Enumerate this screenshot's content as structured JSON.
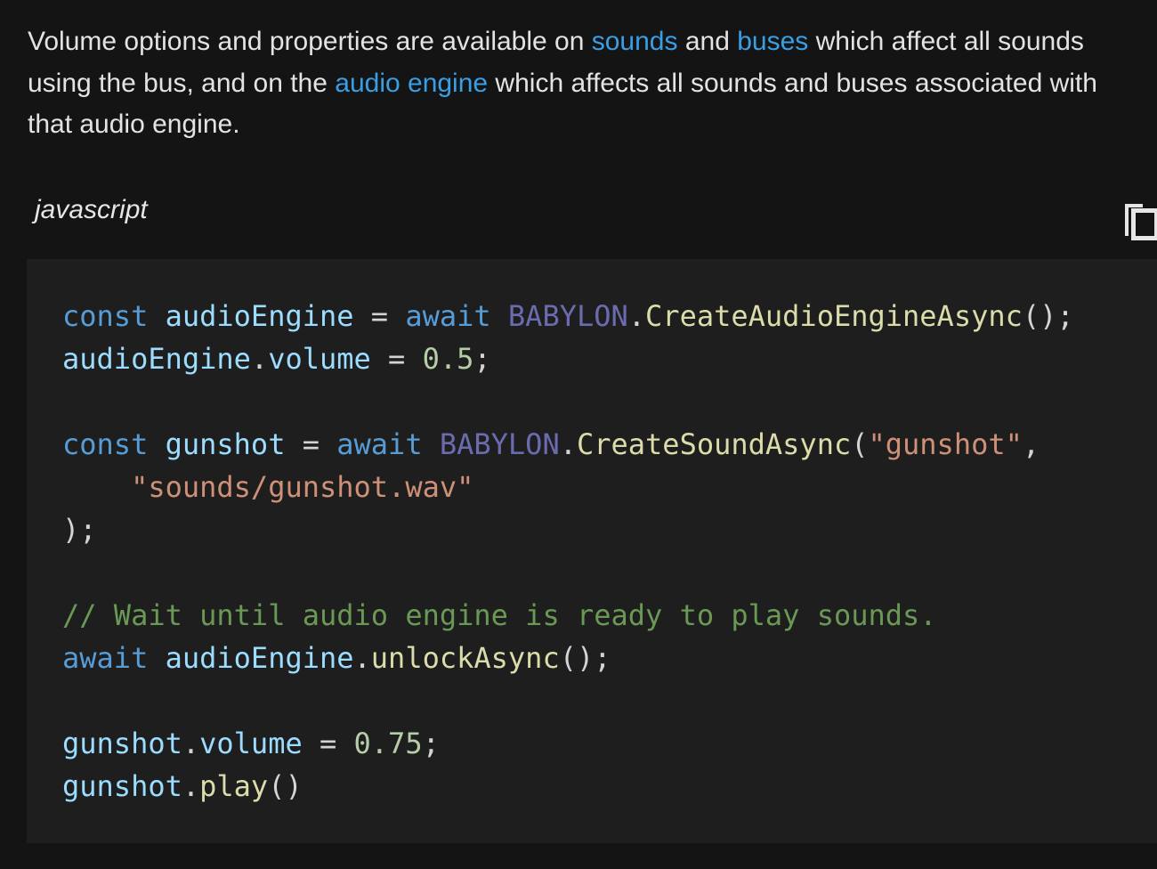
{
  "intro": {
    "t1": "Volume options and properties are available on ",
    "link_sounds": "sounds",
    "t2": " and ",
    "link_buses": "buses",
    "t3": " which affect all sounds using the bus, and on the ",
    "link_audio_engine": "audio engine",
    "t4": " which affects all sounds and buses associated with that audio engine."
  },
  "code_block": {
    "language": "javascript",
    "copy_icon": "copy-icon",
    "lines": [
      [
        {
          "t": "const",
          "c": "kw"
        },
        {
          "t": " ",
          "c": "pun"
        },
        {
          "t": "audioEngine",
          "c": "var"
        },
        {
          "t": " = ",
          "c": "pun"
        },
        {
          "t": "await",
          "c": "kw"
        },
        {
          "t": " ",
          "c": "pun"
        },
        {
          "t": "BABYLON",
          "c": "cls"
        },
        {
          "t": ".",
          "c": "pun"
        },
        {
          "t": "CreateAudioEngineAsync",
          "c": "fn"
        },
        {
          "t": "();",
          "c": "pun"
        }
      ],
      [
        {
          "t": "audioEngine",
          "c": "var"
        },
        {
          "t": ".",
          "c": "pun"
        },
        {
          "t": "volume",
          "c": "var"
        },
        {
          "t": " = ",
          "c": "pun"
        },
        {
          "t": "0.5",
          "c": "num"
        },
        {
          "t": ";",
          "c": "pun"
        }
      ],
      [],
      [
        {
          "t": "const",
          "c": "kw"
        },
        {
          "t": " ",
          "c": "pun"
        },
        {
          "t": "gunshot",
          "c": "var"
        },
        {
          "t": " = ",
          "c": "pun"
        },
        {
          "t": "await",
          "c": "kw"
        },
        {
          "t": " ",
          "c": "pun"
        },
        {
          "t": "BABYLON",
          "c": "cls"
        },
        {
          "t": ".",
          "c": "pun"
        },
        {
          "t": "CreateSoundAsync",
          "c": "fn"
        },
        {
          "t": "(",
          "c": "pun"
        },
        {
          "t": "\"gunshot\"",
          "c": "str"
        },
        {
          "t": ",",
          "c": "pun"
        }
      ],
      [
        {
          "t": "    ",
          "c": "pun"
        },
        {
          "t": "\"sounds/gunshot.wav\"",
          "c": "str"
        }
      ],
      [
        {
          "t": ");",
          "c": "pun"
        }
      ],
      [],
      [
        {
          "t": "// Wait until audio engine is ready to play sounds.",
          "c": "cmt"
        }
      ],
      [
        {
          "t": "await",
          "c": "kw"
        },
        {
          "t": " ",
          "c": "pun"
        },
        {
          "t": "audioEngine",
          "c": "var"
        },
        {
          "t": ".",
          "c": "pun"
        },
        {
          "t": "unlockAsync",
          "c": "fn"
        },
        {
          "t": "();",
          "c": "pun"
        }
      ],
      [],
      [
        {
          "t": "gunshot",
          "c": "var"
        },
        {
          "t": ".",
          "c": "pun"
        },
        {
          "t": "volume",
          "c": "var"
        },
        {
          "t": " = ",
          "c": "pun"
        },
        {
          "t": "0.75",
          "c": "num"
        },
        {
          "t": ";",
          "c": "pun"
        }
      ],
      [
        {
          "t": "gunshot",
          "c": "var"
        },
        {
          "t": ".",
          "c": "pun"
        },
        {
          "t": "play",
          "c": "fn"
        },
        {
          "t": "()",
          "c": "pun"
        }
      ]
    ]
  }
}
